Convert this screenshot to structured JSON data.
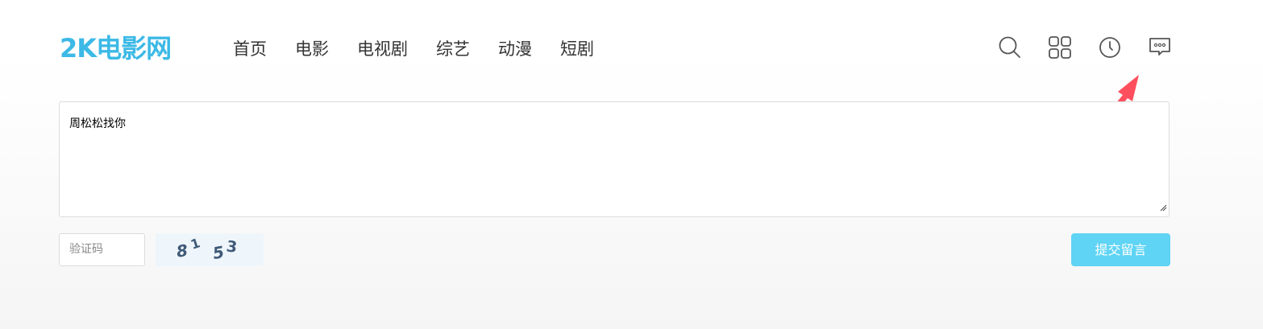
{
  "header": {
    "logo_text": "2K电影网",
    "nav": [
      {
        "label": "首页"
      },
      {
        "label": "电影"
      },
      {
        "label": "电视剧"
      },
      {
        "label": "综艺"
      },
      {
        "label": "动漫"
      },
      {
        "label": "短剧"
      }
    ],
    "icons": [
      "search-icon",
      "grid-icon",
      "history-icon",
      "message-icon"
    ]
  },
  "message_form": {
    "content": "周松松找你",
    "captcha_placeholder": "验证码",
    "captcha_text": "8153",
    "submit_label": "提交留言"
  },
  "colors": {
    "brand": "#3cb9e6",
    "submit_button": "#5fd4f4",
    "arrow": "#ff4f5e"
  }
}
